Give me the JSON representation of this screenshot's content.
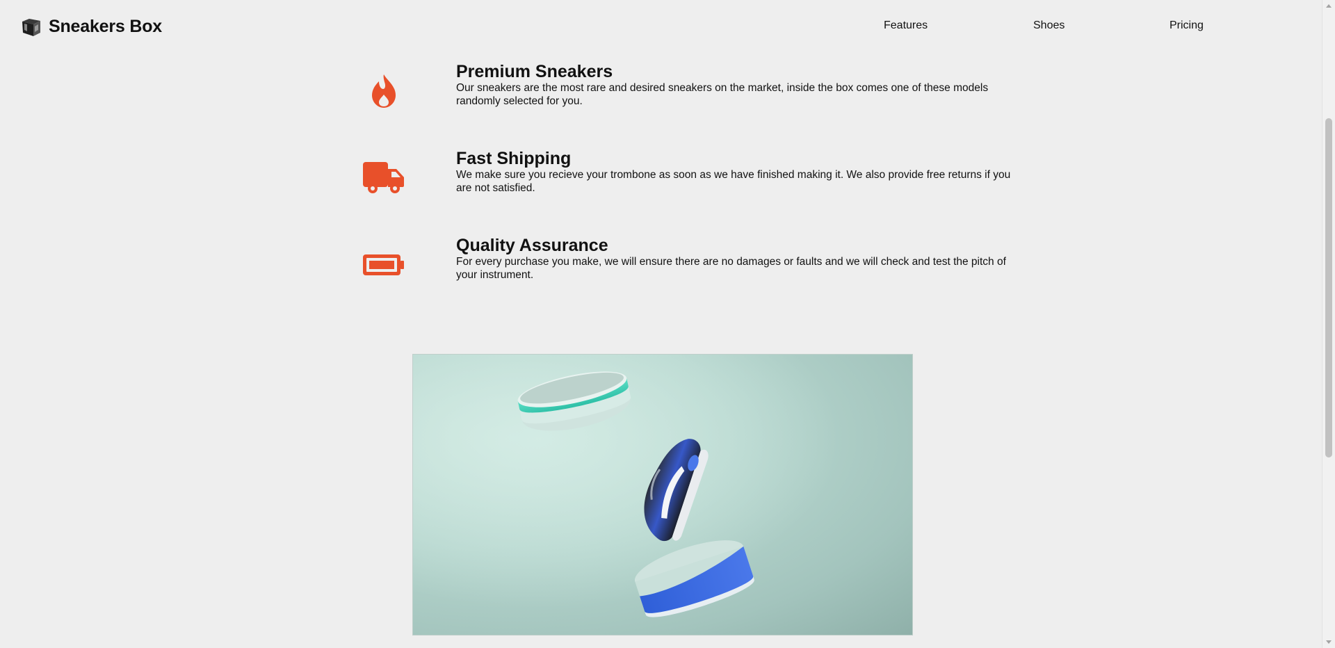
{
  "header": {
    "brand_title": "Sneakers Box",
    "logo_icon": "box-icon",
    "nav": [
      {
        "label": "Features"
      },
      {
        "label": "Shoes"
      },
      {
        "label": "Pricing"
      }
    ]
  },
  "features": [
    {
      "icon": "fire-icon",
      "title": "Premium Sneakers",
      "description": "Our sneakers are the most rare and desired sneakers on the market, inside the box comes one of these models randomly selected for you."
    },
    {
      "icon": "truck-icon",
      "title": "Fast Shipping",
      "description": "We make sure you recieve your trombone as soon as we have finished making it. We also provide free returns if you are not satisfied."
    },
    {
      "icon": "battery-icon",
      "title": "Quality Assurance",
      "description": "For every purchase you make, we will ensure there are no damages or faults and we will check and test the pitch of your instrument."
    }
  ],
  "colors": {
    "accent": "#e8502a",
    "background": "#eeeeee",
    "text": "#111111"
  }
}
